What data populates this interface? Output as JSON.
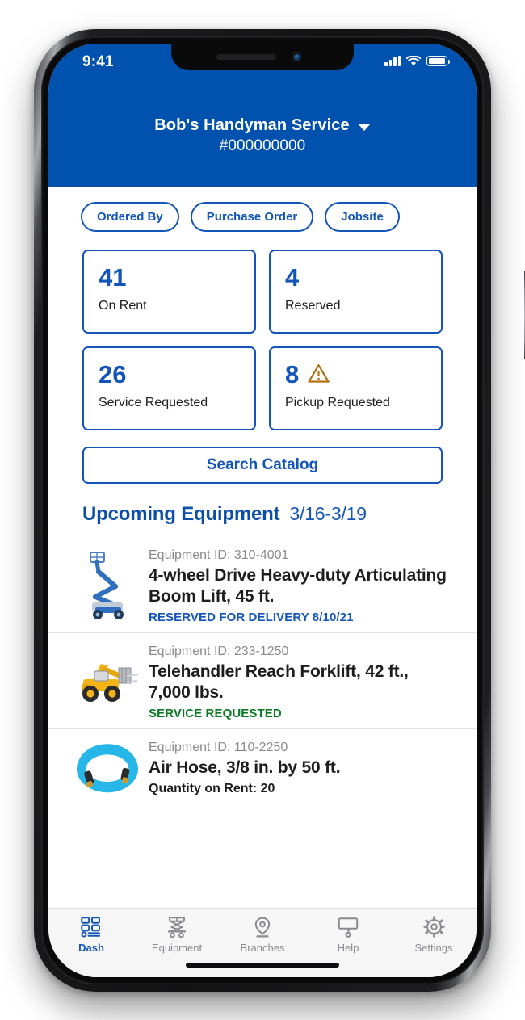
{
  "status_bar": {
    "time": "9:41",
    "cellular_icon": "cellular-signal-icon",
    "wifi_icon": "wifi-icon",
    "battery_icon": "battery-full-icon"
  },
  "header": {
    "account_name": "Bob's Handyman Service",
    "caret_icon": "chevron-down-icon",
    "account_number": "#000000000",
    "background_color": "#0052AE"
  },
  "filters": {
    "chips": [
      {
        "label": "Ordered By"
      },
      {
        "label": "Purchase Order"
      },
      {
        "label": "Jobsite"
      }
    ]
  },
  "stats": {
    "cards": [
      {
        "value": "41",
        "label": "On Rent",
        "warning": false
      },
      {
        "value": "4",
        "label": "Reserved",
        "warning": false
      },
      {
        "value": "26",
        "label": "Service Requested",
        "warning": false
      },
      {
        "value": "8",
        "label": "Pickup Requested",
        "warning": true,
        "warning_icon": "warning-triangle-icon"
      }
    ]
  },
  "search": {
    "catalog_label": "Search Catalog"
  },
  "upcoming": {
    "title": "Upcoming Equipment",
    "date_range": "3/16-3/19",
    "items": [
      {
        "id_label": "Equipment ID: 310-4001",
        "name": "4-wheel Drive Heavy-duty Articulating Boom Lift, 45 ft.",
        "status": "RESERVED FOR DELIVERY 8/10/21",
        "status_type": "reserved",
        "thumb_icon": "articulating-boom-lift-image"
      },
      {
        "id_label": "Equipment ID: 233-1250",
        "name": "Telehandler Reach Forklift, 42 ft., 7,000 lbs.",
        "status": "SERVICE REQUESTED",
        "status_type": "service",
        "thumb_icon": "telehandler-forklift-image"
      },
      {
        "id_label": "Equipment ID: 110-2250",
        "name": "Air Hose, 3/8 in. by 50 ft.",
        "meta": "Quantity on Rent: 20",
        "thumb_icon": "air-hose-image"
      }
    ]
  },
  "tab_bar": {
    "items": [
      {
        "label": "Dash",
        "icon": "dashboard-grid-icon",
        "active": true
      },
      {
        "label": "Equipment",
        "icon": "scissor-lift-icon",
        "active": false
      },
      {
        "label": "Branches",
        "icon": "map-pin-icon",
        "active": false
      },
      {
        "label": "Help",
        "icon": "question-bubble-icon",
        "active": false
      },
      {
        "label": "Settings",
        "icon": "gear-icon",
        "active": false
      }
    ]
  },
  "colors": {
    "brand_blue": "#0052AE",
    "accent_blue": "#1355B8",
    "warning_amber": "#B06A08",
    "success_green": "#0B7A24",
    "muted_gray": "#8a8a8e"
  }
}
